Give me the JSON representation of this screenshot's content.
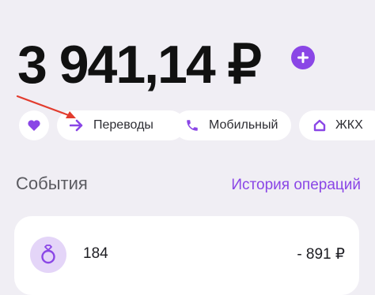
{
  "balance": {
    "amount": "3 941,14 ₽"
  },
  "quick_actions": {
    "favorites_icon": "heart-icon",
    "items": [
      {
        "label": "Переводы",
        "icon": "arrow-right-icon"
      },
      {
        "label": "Мобильный",
        "icon": "phone-icon"
      },
      {
        "label": "ЖКХ",
        "icon": "house-icon"
      }
    ]
  },
  "events": {
    "title": "События",
    "history_link": "История операций",
    "operations": [
      {
        "name": "184",
        "amount": "- 891 ₽",
        "icon": "ring-icon"
      }
    ]
  },
  "colors": {
    "accent": "#8a46e6",
    "background": "#f0eef4",
    "annotation_arrow": "#e23c2e"
  }
}
